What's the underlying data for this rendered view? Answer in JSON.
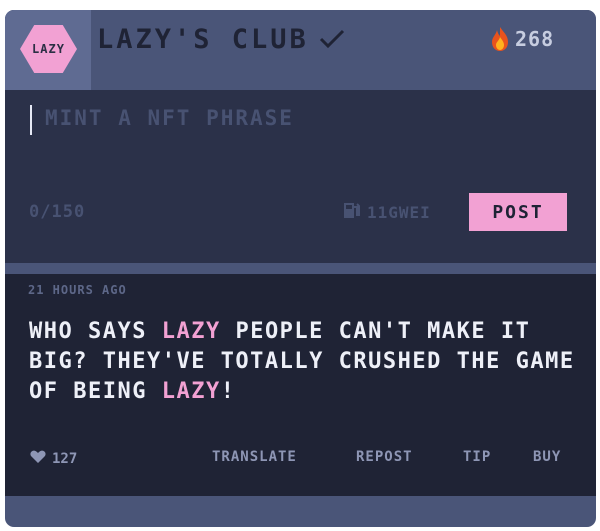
{
  "header": {
    "logo_text": "LAZY",
    "club_name": "LAZY'S CLUB",
    "fire_count": "268"
  },
  "composer": {
    "placeholder": "MINT A NFT PHRASE",
    "char_count": "0/150",
    "gas": "11GWEI",
    "post_label": "POST"
  },
  "post": {
    "timestamp": "21 HOURS AGO",
    "segments": [
      {
        "text": "WHO SAYS ",
        "highlight": false
      },
      {
        "text": "LAZY",
        "highlight": true
      },
      {
        "text": " PEOPLE CAN'T MAKE IT BIG? THEY'VE TOTALLY CRUSHED THE GAME OF BEING ",
        "highlight": false
      },
      {
        "text": "LAZY",
        "highlight": true
      },
      {
        "text": "!",
        "highlight": false
      }
    ],
    "likes": "127",
    "actions": {
      "translate": "TRANSLATE",
      "repost": "REPOST",
      "tip": "TIP",
      "buy": "BUY"
    }
  },
  "colors": {
    "accent_pink": "#f2a1d3",
    "header_bg": "#4a5578",
    "composer_bg": "#2b3149",
    "post_bg": "#1f2335"
  },
  "icons": [
    "verified-check-icon",
    "flame-icon",
    "gas-pump-icon",
    "heart-icon"
  ]
}
